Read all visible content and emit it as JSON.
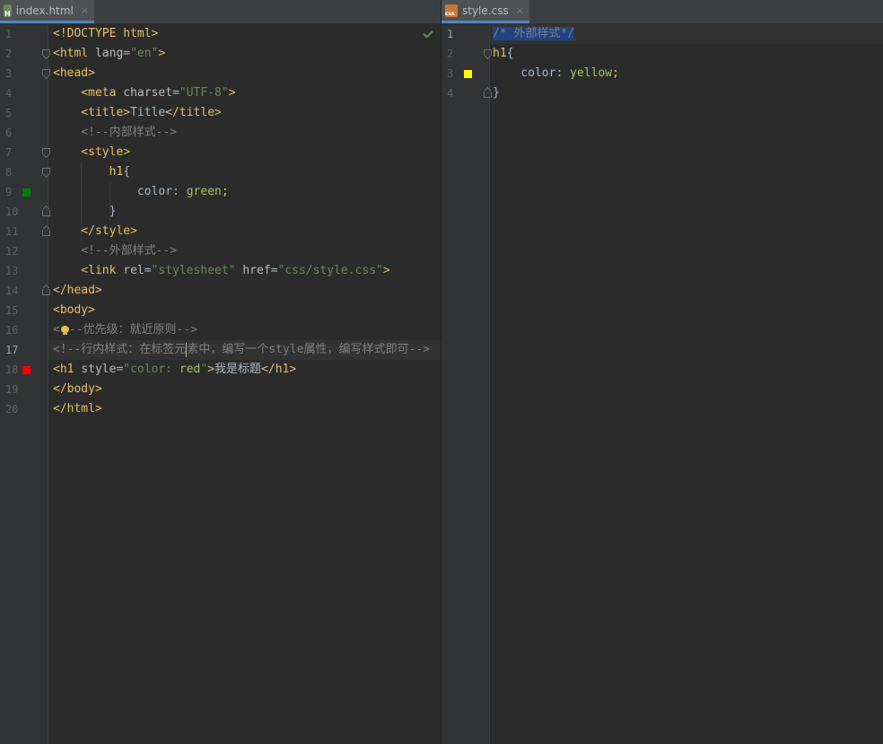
{
  "left_tab": {
    "label": "index.html",
    "close": "×",
    "icon": "html-file-icon"
  },
  "right_tab": {
    "label": "style.css",
    "close": "×",
    "icon": "css-file-icon"
  },
  "html_lines": [
    {
      "n": "1"
    },
    {
      "n": "2"
    },
    {
      "n": "3"
    },
    {
      "n": "4"
    },
    {
      "n": "5"
    },
    {
      "n": "6"
    },
    {
      "n": "7"
    },
    {
      "n": "8"
    },
    {
      "n": "9"
    },
    {
      "n": "10"
    },
    {
      "n": "11"
    },
    {
      "n": "12"
    },
    {
      "n": "13"
    },
    {
      "n": "14"
    },
    {
      "n": "15"
    },
    {
      "n": "16"
    },
    {
      "n": "17"
    },
    {
      "n": "18"
    },
    {
      "n": "19"
    },
    {
      "n": "20"
    }
  ],
  "html_code": {
    "l1": "<!DOCTYPE html>",
    "l2a": "<html ",
    "l2b": "lang",
    "l2c": "=",
    "l2d": "\"en\"",
    "l2e": ">",
    "l3": "<head>",
    "l4a": "    <meta ",
    "l4b": "charset",
    "l4c": "=",
    "l4d": "\"UTF-8\"",
    "l4e": ">",
    "l5a": "    <title>",
    "l5b": "Title",
    "l5c": "</title>",
    "l6": "    <!--内部样式-->",
    "l7": "    <style>",
    "l8a": "        ",
    "l8b": "h1",
    "l8c": "{",
    "l9a": "            color",
    "l9b": ": ",
    "l9c": "green",
    "l9d": ";",
    "l10": "        }",
    "l11": "    </style>",
    "l12": "    <!--外部样式-->",
    "l13a": "    <link ",
    "l13b": "rel",
    "l13c": "=",
    "l13d": "\"stylesheet\"",
    "l13e": " href",
    "l13f": "=",
    "l13g": "\"css/style.css\"",
    "l13h": ">",
    "l14": "</head>",
    "l15": "<body>",
    "l16a": "<",
    "l16b": "--优先级：就近原则-->",
    "l17a": "<!--行内样式：在标签元",
    "l17b": "素中，编写一个style属性，编写样式即可-->",
    "l18a": "<h1 ",
    "l18b": "style",
    "l18c": "=",
    "l18d": "\"color: ",
    "l18e": "red",
    "l18f": "\"",
    "l18g": ">",
    "l18h": "我是标题",
    "l18i": "</h1>",
    "l19": "</body>",
    "l20": "</html>"
  },
  "css_lines": [
    {
      "n": "1"
    },
    {
      "n": "2"
    },
    {
      "n": "3"
    },
    {
      "n": "4"
    }
  ],
  "css_code": {
    "l1": "/* 外部样式*/",
    "l2a": "h1",
    "l2b": "{",
    "l3a": "    color",
    "l3b": ": ",
    "l3c": "yellow",
    "l3d": ";",
    "l4": "}"
  },
  "colors": {
    "green_swatch": "#008000",
    "red_swatch": "#ff0000",
    "yellow_swatch": "#ffff00",
    "tab_underline": "#4a88c7",
    "background": "#2b2b2b"
  }
}
